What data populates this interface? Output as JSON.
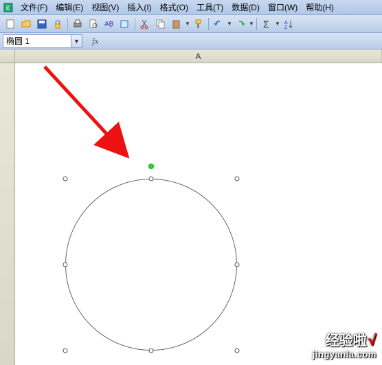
{
  "menu": {
    "file": "文件(F)",
    "edit": "编辑(E)",
    "view": "视图(V)",
    "insert": "插入(I)",
    "format": "格式(O)",
    "tools": "工具(T)",
    "data": "数据(D)",
    "window": "窗口(W)",
    "help": "帮助(H)"
  },
  "namebox": {
    "value": "椭圆 1"
  },
  "formula": {
    "fx_label": "fx",
    "value": ""
  },
  "columns": {
    "a": "A"
  },
  "shape": {
    "type": "ellipse",
    "selected": true
  },
  "watermark": {
    "title": "经验啦",
    "check": "√",
    "url": "jingyanla.com"
  },
  "icons": {
    "app": "excel-icon",
    "new": "new-icon",
    "open": "open-icon",
    "save": "save-icon",
    "permission": "permission-icon",
    "print": "print-icon",
    "preview": "preview-icon",
    "spell": "spell-icon",
    "cut": "cut-icon",
    "copy": "copy-icon",
    "paste": "paste-icon",
    "format_painter": "format-painter-icon",
    "undo": "undo-icon",
    "redo": "redo-icon",
    "sum": "sum-icon",
    "sort": "sort-icon"
  }
}
